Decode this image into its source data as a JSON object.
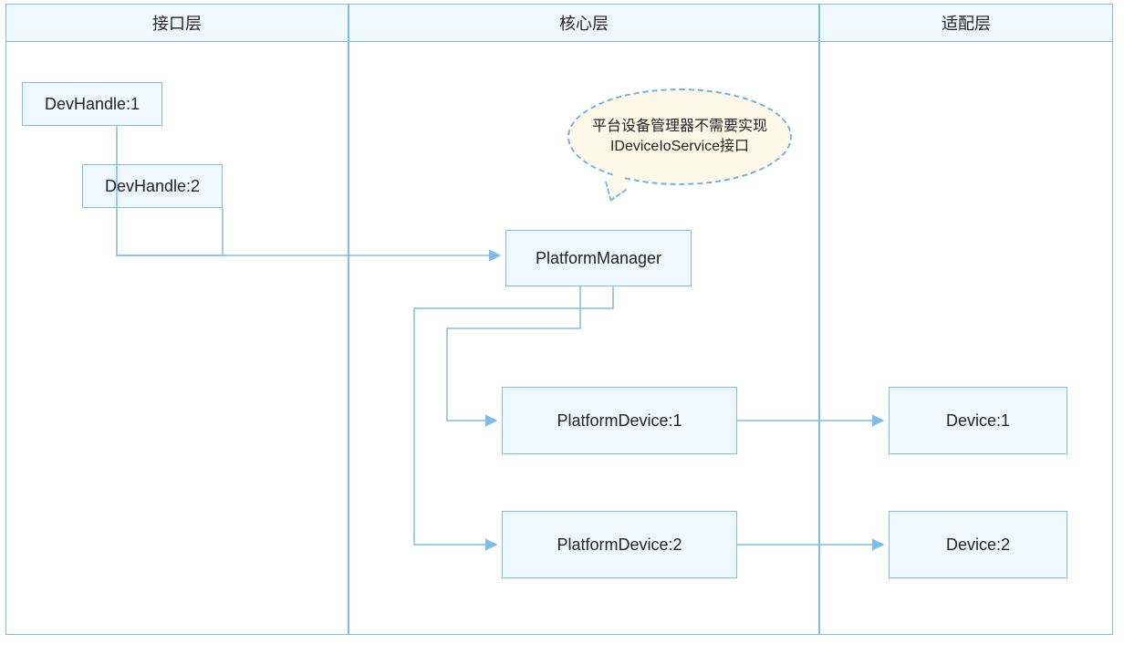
{
  "columns": {
    "interface": {
      "header": "接口层"
    },
    "core": {
      "header": "核心层"
    },
    "adapter": {
      "header": "适配层"
    }
  },
  "boxes": {
    "devhandle1": "DevHandle:1",
    "devhandle2": "DevHandle:2",
    "platformManager": "PlatformManager",
    "platformDevice1": "PlatformDevice:1",
    "platformDevice2": "PlatformDevice:2",
    "device1": "Device:1",
    "device2": "Device:2"
  },
  "callout": "平台设备管理器不需要实现IDeviceIoService接口"
}
